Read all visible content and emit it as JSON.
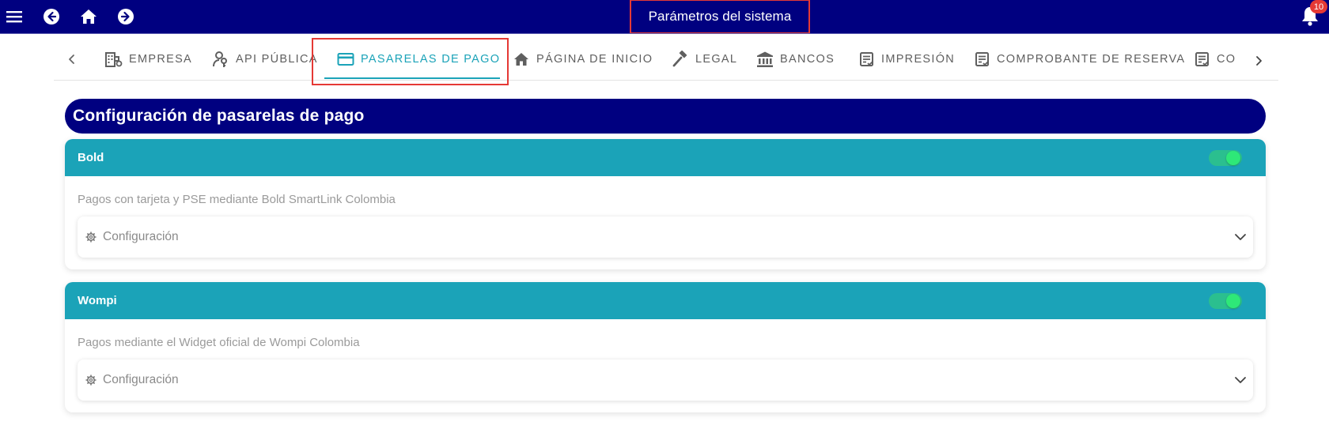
{
  "topbar": {
    "title": "Parámetros del sistema",
    "notification_count": "10",
    "icons": [
      "menu-icon",
      "back-icon",
      "home-icon",
      "forward-icon",
      "bell-icon"
    ]
  },
  "tabs": [
    {
      "label": "EMPRESA",
      "icon": "building-cog-icon"
    },
    {
      "label": "API PÚBLICA",
      "icon": "key-person-icon"
    },
    {
      "label": "PASARELAS DE PAGO",
      "icon": "credit-card-icon",
      "active": true
    },
    {
      "label": "PÁGINA DE INICIO",
      "icon": "home-icon"
    },
    {
      "label": "LEGAL",
      "icon": "gavel-icon"
    },
    {
      "label": "BANCOS",
      "icon": "bank-icon"
    },
    {
      "label": "IMPRESIÓN",
      "icon": "document-check-icon"
    },
    {
      "label": "COMPROBANTE DE RESERVA",
      "icon": "document-check-icon"
    },
    {
      "label": "CO",
      "icon": "document-check-icon"
    }
  ],
  "section": {
    "title": "Configuración de pasarelas de pago"
  },
  "gateways": [
    {
      "name": "Bold",
      "enabled": true,
      "description": "Pagos con tarjeta y PSE mediante Bold SmartLink Colombia",
      "config_label": "Configuración"
    },
    {
      "name": "Wompi",
      "enabled": true,
      "description": "Pagos mediante el Widget oficial de Wompi Colombia",
      "config_label": "Configuración"
    }
  ],
  "colors": {
    "primary": "#000080",
    "accent": "#1ba3b8",
    "toggle_on": "#2ee878",
    "highlight": "#e53935"
  }
}
